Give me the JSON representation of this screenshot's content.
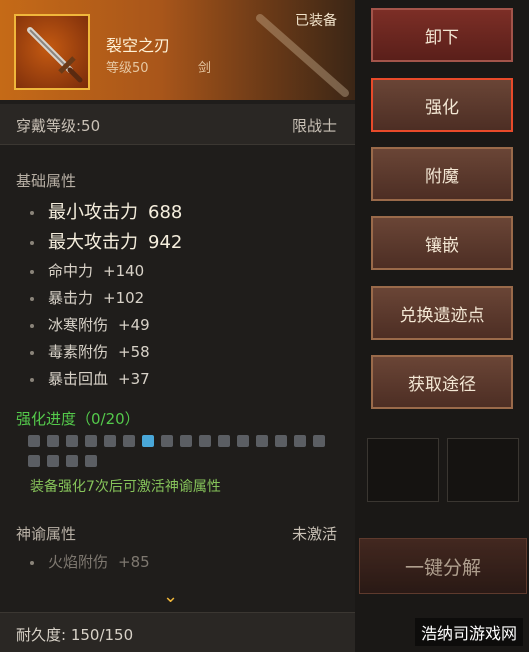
{
  "item": {
    "name": "裂空之刃",
    "level": "等级50",
    "type": "剑",
    "equipped": "已装备",
    "requirement": "穿戴等级:50",
    "class_limit": "限战士"
  },
  "basic": {
    "title": "基础属性",
    "stats": [
      {
        "name": "最小攻击力",
        "value": "688"
      },
      {
        "name": "最大攻击力",
        "value": "942"
      },
      {
        "name": "命中力",
        "value": "+140"
      },
      {
        "name": "暴击力",
        "value": "+102"
      },
      {
        "name": "冰寒附伤",
        "value": "+49"
      },
      {
        "name": "毒素附伤",
        "value": "+58"
      },
      {
        "name": "暴击回血",
        "value": "+37"
      }
    ]
  },
  "enhance": {
    "label": "强化进度（0/20）",
    "filled": 0,
    "total": 20,
    "hint": "装备强化7次后可激活神谕属性"
  },
  "oracle": {
    "title": "神谕属性",
    "status": "未激活",
    "stat_name": "火焰附伤",
    "stat_value": "+85"
  },
  "durability": "耐久度:  150/150",
  "buttons": {
    "unequip": "卸下",
    "enhance": "强化",
    "enchant": "附魔",
    "inlay": "镶嵌",
    "exchange": "兑换遗迹点",
    "obtain": "获取途径",
    "decompose": "一键分解"
  },
  "watermark": "浩纳司游戏网",
  "colors": {
    "header": "#c56a17",
    "progress_label": "#54c94b",
    "hint": "#86c35a",
    "active_square": "#49a7d8"
  }
}
